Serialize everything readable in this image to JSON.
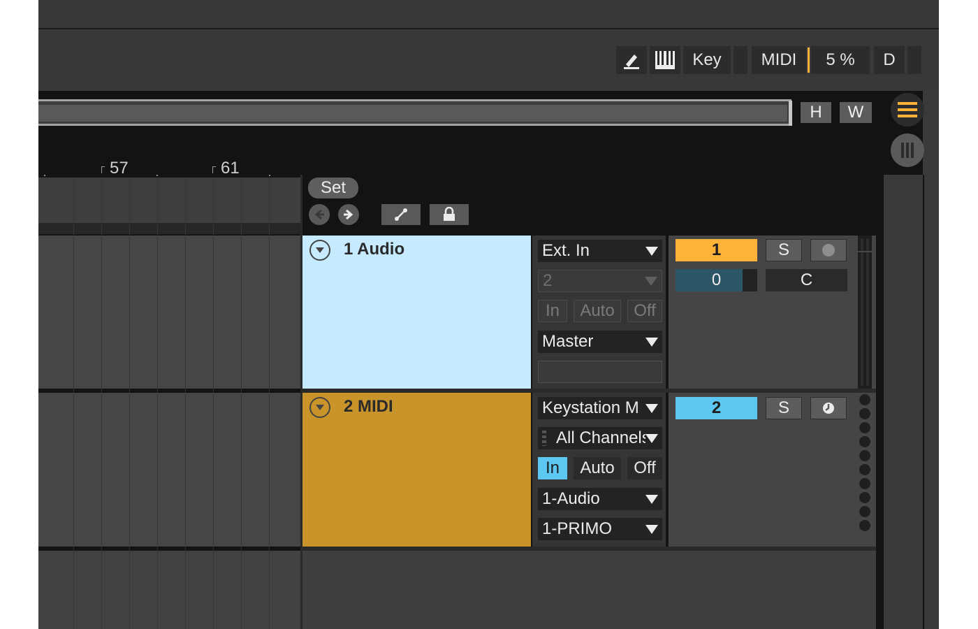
{
  "toolbar": {
    "key_label": "Key",
    "midi_label": "MIDI",
    "cpu_label": "5 %",
    "d_label": "D"
  },
  "overview": {
    "h_label": "H",
    "w_label": "W"
  },
  "ruler": {
    "marks": [
      "57",
      "61"
    ]
  },
  "session": {
    "set_label": "Set"
  },
  "tracks": [
    {
      "name": "1 Audio",
      "color": "#c6eaff",
      "input": "Ext. In",
      "input_channel": "2",
      "monitor": [
        "In",
        "Auto",
        "Off"
      ],
      "output": "Master",
      "number": "1",
      "number_color": "#ffb338",
      "solo": "S",
      "pan_value": "0",
      "pan_label": "C"
    },
    {
      "name": "2 MIDI",
      "color": "#c9952a",
      "input": "Keystation M",
      "input_channel": "All Channels",
      "monitor": [
        "In",
        "Auto",
        "Off"
      ],
      "output": "1-Audio",
      "output_channel": "1-PRIMO",
      "number": "2",
      "number_color": "#5cc7f1",
      "solo": "S"
    }
  ],
  "colors": {
    "accent_orange": "#ffb338",
    "accent_blue": "#5cc7f1"
  }
}
